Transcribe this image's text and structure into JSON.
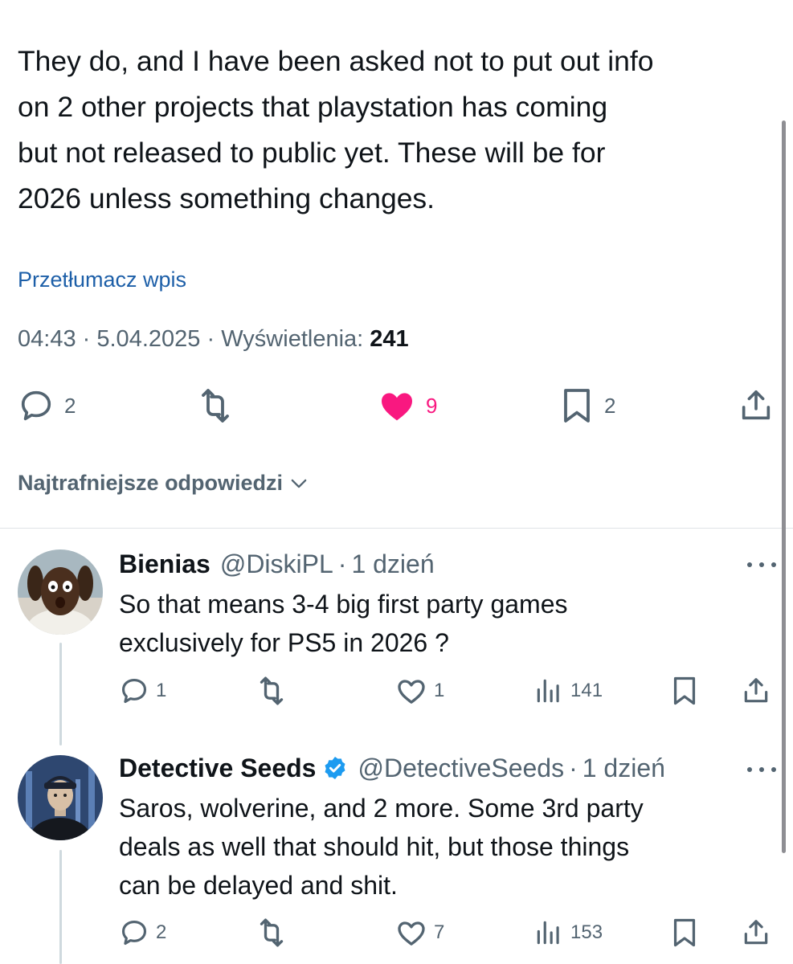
{
  "tweet": {
    "text_lines": [
      "They do, and I have been asked not to put out info",
      "on 2 other projects that playstation has coming",
      "but not released to public yet. These will be for",
      "2026 unless something changes."
    ],
    "translate_label": "Przetłumacz wpis",
    "time": "04:43",
    "date": "5.04.2025",
    "views_label": "Wyświetlenia:",
    "views": "241",
    "separator": "·",
    "actions": {
      "replies": "2",
      "likes": "9",
      "bookmarks": "2",
      "like_color": "#f91880"
    }
  },
  "replies_sort": {
    "label": "Najtrafniejsze odpowiedzi"
  },
  "replies": [
    {
      "name": "Bienias",
      "handle": "@DiskiPL",
      "age": "1 dzień",
      "verified": false,
      "text_lines": [
        "So that means 3-4 big first party games",
        "exclusively for PS5 in 2026 ?"
      ],
      "replies": "1",
      "likes": "1",
      "views": "141"
    },
    {
      "name": "Detective Seeds",
      "handle": "@DetectiveSeeds",
      "age": "1 dzień",
      "verified": true,
      "text_lines": [
        "Saros, wolverine, and 2 more. Some 3rd party",
        "deals as well that should hit, but those things",
        "can be delayed and shit."
      ],
      "replies": "2",
      "likes": "7",
      "views": "153"
    }
  ],
  "colors": {
    "text": "#0f1419",
    "secondary": "#536471",
    "link": "#1d5fa8",
    "verified": "#1d9bf0"
  }
}
